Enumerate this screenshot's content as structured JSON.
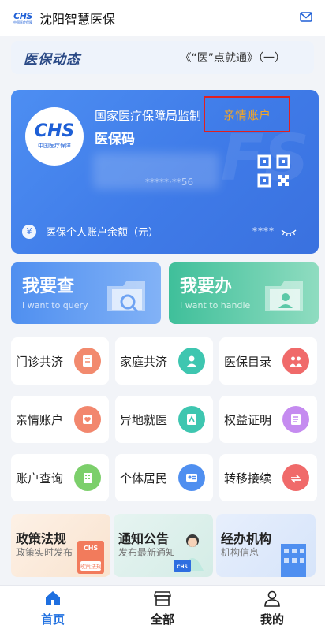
{
  "header": {
    "logo_text": "CHS",
    "logo_sub": "中国医疗保障",
    "title": "沈阳智慧医保"
  },
  "news": {
    "brand": "医保动态",
    "headline": "《“医”点就通》（一）"
  },
  "card": {
    "logo_text": "CHS",
    "logo_sub": "中国医疗保障",
    "authority": "国家医疗保障局监制",
    "code_label": "医保码",
    "family_account": "亲情账户",
    "masked_id": "*****·**56",
    "balance_label": "医保个人账户余额（元）",
    "balance_masked": "****"
  },
  "tiles": [
    {
      "title": "我要查",
      "subtitle": "I want to query"
    },
    {
      "title": "我要办",
      "subtitle": "I want to handle"
    }
  ],
  "grid": [
    {
      "label": "门诊共济",
      "icon": "document-icon",
      "color": "#f28a6e"
    },
    {
      "label": "家庭共济",
      "icon": "doctor-icon",
      "color": "#3ec6b0"
    },
    {
      "label": "医保目录",
      "icon": "family-icon",
      "color": "#f06a6a"
    },
    {
      "label": "亲情账户",
      "icon": "heart-book-icon",
      "color": "#f2876e"
    },
    {
      "label": "异地就医",
      "icon": "travel-icon",
      "color": "#3ec6b0"
    },
    {
      "label": "权益证明",
      "icon": "certificate-icon",
      "color": "#c58bf0"
    },
    {
      "label": "账户查询",
      "icon": "building-icon",
      "color": "#7ccf6b"
    },
    {
      "label": "个体居民",
      "icon": "id-card-icon",
      "color": "#4f8ff0"
    },
    {
      "label": "转移接续",
      "icon": "transfer-icon",
      "color": "#f06a6a"
    }
  ],
  "info_cards": [
    {
      "title": "政策法规",
      "subtitle": "政策实时发布",
      "badge": "政策法规"
    },
    {
      "title": "通知公告",
      "subtitle": "发布最新通知",
      "badge": "CHS"
    },
    {
      "title": "经办机构",
      "subtitle": "机构信息"
    }
  ],
  "tabbar": [
    {
      "label": "首页",
      "icon": "home-icon",
      "active": true
    },
    {
      "label": "全部",
      "icon": "store-icon",
      "active": false
    },
    {
      "label": "我的",
      "icon": "user-icon",
      "active": false
    }
  ],
  "colors": {
    "primary": "#1e5fd6",
    "active_tab": "#1e6fe0",
    "highlight": "#f5a623",
    "annotation_box": "#e02020"
  }
}
